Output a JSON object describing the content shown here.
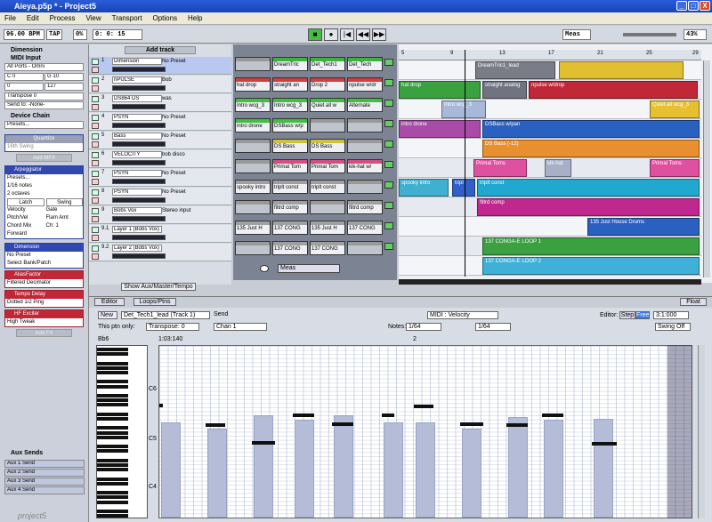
{
  "window": {
    "title": "Aieya.p5p * - Project5",
    "min": "_",
    "max": "□",
    "close": "X"
  },
  "menu": [
    "File",
    "Edit",
    "Process",
    "View",
    "Transport",
    "Options",
    "Help"
  ],
  "toolbar": {
    "bpm": "96.00 BPM",
    "tap": "TAP",
    "percent": "0%",
    "position": "0: 0: 15",
    "meas": "Meas",
    "zoom": "43%",
    "play": "■",
    "rec": "●",
    "rew": "|◀",
    "back": "◀◀",
    "fwd": "▶▶"
  },
  "left": {
    "dimension_title": "Dimension",
    "midi_input": "MIDI Input",
    "all_ports": "All Ports - Omni",
    "range_lo": "C 0",
    "range_hi": "G 10",
    "vel_lo": "0",
    "vel_hi": "127",
    "transpose": "Transpose 0",
    "send_to": "Send to: -None-",
    "device_chain": "Device Chain",
    "presets": "Presets...",
    "quantize": "Quantize",
    "swing": "16th Swing",
    "add_mfx": "Add MFX",
    "arp": "Arpeggiator",
    "arp_presets": "Presets...",
    "notes": "1/16 notes",
    "octaves": "2 octaves",
    "latch": "Latch",
    "swing_btn": "Swing",
    "velocity": "Velocity",
    "gate": "Gate",
    "pitch_vel": "Pitch/Vel",
    "flam_amt": "Flam Amt",
    "chord_mix": "Chord Mix",
    "ch": "Ch: 1",
    "forward": "Forward",
    "synth": "Dimension",
    "no_preset": "No Preset",
    "select_bank": "Select Bank/Patch",
    "fx": [
      {
        "name": "AliasFactor",
        "preset": "Filtered Decimator"
      },
      {
        "name": "Tempo Delay",
        "preset": "Dotted 1/2 Ping"
      },
      {
        "name": "HF Exciter",
        "preset": "High Tweak"
      }
    ],
    "add_fx": "Add FX",
    "aux_sends": "Aux Sends",
    "aux": [
      "Aux 1 Send",
      "Aux 2 Send",
      "Aux 3 Send",
      "Aux 4 Send"
    ],
    "logo": "project5"
  },
  "tracks": {
    "add_track": "Add track",
    "show_aux": "Show Aux/Master/Tempo",
    "rows": [
      {
        "n": "1",
        "name": "Dimension",
        "preset": "No Preset"
      },
      {
        "n": "2",
        "name": "nPULSE",
        "preset": "Bob"
      },
      {
        "n": "3",
        "name": "DS864 DS",
        "preset": "was"
      },
      {
        "n": "4",
        "name": "PSYN",
        "preset": "No Preset"
      },
      {
        "n": "5",
        "name": "Bass",
        "preset": "No Preset"
      },
      {
        "n": "6",
        "name": "VELOCITY",
        "preset": "bob disco"
      },
      {
        "n": "7",
        "name": "PSYN",
        "preset": "No Preset"
      },
      {
        "n": "8",
        "name": "PSYN",
        "preset": "No Preset"
      },
      {
        "n": "9",
        "name": "Bobs Vox",
        "preset": "Stereo input"
      },
      {
        "n": "9.1",
        "name": "Layer 1 (Bobs Vox)",
        "preset": ""
      },
      {
        "n": "9.2",
        "name": "Layer 2 (Bobs Vox)",
        "preset": ""
      }
    ]
  },
  "clips": {
    "meas": "Meas",
    "cells": [
      [
        "",
        "DreamTric",
        "Det_Tech1",
        "Det_Tech"
      ],
      [
        "hat drop",
        "straight an",
        "Drop 2",
        "npulse w/dr"
      ],
      [
        "Intro wcg_3",
        "Intro wcg_3",
        "Quiet all w",
        "Alternate"
      ],
      [
        "intro drone",
        "DSBass w/p",
        "",
        ""
      ],
      [
        "",
        "DS Bass",
        "DS Bass",
        ""
      ],
      [
        "",
        "Primal Tom",
        "Primal Tom",
        "kik-hat w/"
      ],
      [
        "spooky intro",
        "triplt const",
        "triplt const",
        ""
      ],
      [
        "",
        "filtrd comp",
        "",
        "filtrd comp"
      ],
      [
        "135 Just H",
        "137 CONG",
        "135 Just H",
        "137 CONG"
      ],
      [
        "",
        "137 CONG",
        "137 CONG",
        ""
      ]
    ]
  },
  "arrange": {
    "ruler": [
      "5",
      "9",
      "13",
      "17",
      "21",
      "25",
      "29"
    ],
    "clips": [
      {
        "lane": 0,
        "l": 86,
        "w": 90,
        "t": "DreamTric1_lead",
        "c": "#7a7c88"
      },
      {
        "lane": 0,
        "l": 180,
        "w": 140,
        "t": "",
        "c": "#e0c030"
      },
      {
        "lane": 1,
        "l": 0,
        "w": 92,
        "t": "hat drop",
        "c": "#3aa040"
      },
      {
        "lane": 1,
        "l": 94,
        "w": 50,
        "t": "straight analog",
        "c": "#707480"
      },
      {
        "lane": 1,
        "l": 146,
        "w": 190,
        "t": "npulse w/drop",
        "c": "#c02838"
      },
      {
        "lane": 2,
        "l": 48,
        "w": 50,
        "t": "Intro wcg_3",
        "c": "#a8b8d8"
      },
      {
        "lane": 2,
        "l": 282,
        "w": 56,
        "t": "Quiet all wcg_3",
        "c": "#e6c030"
      },
      {
        "lane": 3,
        "l": 0,
        "w": 92,
        "t": "intro drone",
        "c": "#a84ca8"
      },
      {
        "lane": 3,
        "l": 94,
        "w": 244,
        "t": "DSBass w/pan",
        "c": "#2a60c0"
      },
      {
        "lane": 4,
        "l": 94,
        "w": 244,
        "t": "DS Bass (-12)",
        "c": "#e89030"
      },
      {
        "lane": 5,
        "l": 84,
        "w": 60,
        "t": "Primal Toms",
        "c": "#e050a0"
      },
      {
        "lane": 5,
        "l": 164,
        "w": 30,
        "t": "kik-hat",
        "c": "#a8b0c8"
      },
      {
        "lane": 5,
        "l": 282,
        "w": 56,
        "t": "Primal Toms",
        "c": "#e050a0"
      },
      {
        "lane": 6,
        "l": 0,
        "w": 56,
        "t": "spooky intro",
        "c": "#40b0d0"
      },
      {
        "lane": 6,
        "l": 60,
        "w": 26,
        "t": "tripl",
        "c": "#3060c8"
      },
      {
        "lane": 6,
        "l": 88,
        "w": 250,
        "t": "triplt const",
        "c": "#20a8d0"
      },
      {
        "lane": 7,
        "l": 88,
        "w": 250,
        "t": "filtrd comp",
        "c": "#c02890"
      },
      {
        "lane": 8,
        "l": 212,
        "w": 126,
        "t": "135 Just House Drums",
        "c": "#2a60c0"
      },
      {
        "lane": 9,
        "l": 94,
        "w": 244,
        "t": "137 CONGA-E LOOP 1",
        "c": "#3aa040"
      },
      {
        "lane": 10,
        "l": 94,
        "w": 244,
        "t": "137 CONGA-E LOOP 2",
        "c": "#40b0d8"
      }
    ]
  },
  "editor": {
    "tab1": "Editor",
    "tab2": "Loops/Ptns",
    "float": "Float",
    "new": "New",
    "pattern": "Det_Tech1_lead (Track 1)",
    "send": "Send",
    "this_ptn": "This ptn only:",
    "transpose": "Transpose: 0",
    "chan": "Chan 1",
    "midi_vel": "MIDI : Velocity",
    "editor_label": "Editor:",
    "step": "Step",
    "free": "Free",
    "pos": "3:1:000",
    "notes_label": "Notes:",
    "note_len": "1/64",
    "note_len2": "1/64",
    "swing_off": "Swing Off",
    "bb6": "Bb6",
    "time": "1:03:140",
    "c6": "C6",
    "c5": "C5",
    "c4": "C4",
    "bar2": "2"
  }
}
